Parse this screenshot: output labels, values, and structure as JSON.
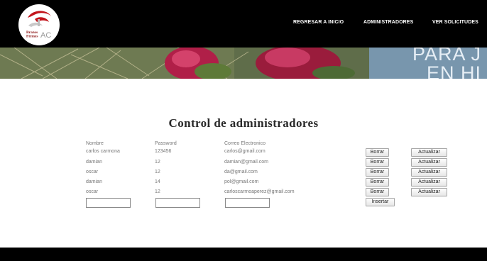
{
  "header": {
    "logo": {
      "line1": "Brazos",
      "line2": "Firmes",
      "suffix": "AC"
    },
    "nav": [
      "REGRESAR A INICIO",
      "ADMINISTRADORES",
      "VER SOLICITUDES"
    ]
  },
  "banner": {
    "line1": "PARA J",
    "line2": "EN HI"
  },
  "main": {
    "title": "Control de administradores",
    "columns": [
      "Nombre",
      "Password",
      "Correo Electronico"
    ],
    "rows": [
      {
        "nombre": "carlos carmona",
        "password": "123456",
        "correo": "carlos@gmail.com"
      },
      {
        "nombre": "damian",
        "password": "12",
        "correo": "damian@gmail.com"
      },
      {
        "nombre": "oscar",
        "password": "12",
        "correo": "da@gmail.com"
      },
      {
        "nombre": "damian",
        "password": "14",
        "correo": "pol@gmail.com"
      },
      {
        "nombre": "oscar",
        "password": "12",
        "correo": "carloscarmoaperez@gmail.com"
      }
    ],
    "delete_label": "Borrar",
    "update_label": "Actualizar",
    "insert_label": "Insertar",
    "new_row": {
      "nombre": "",
      "password": "",
      "correo": ""
    }
  }
}
